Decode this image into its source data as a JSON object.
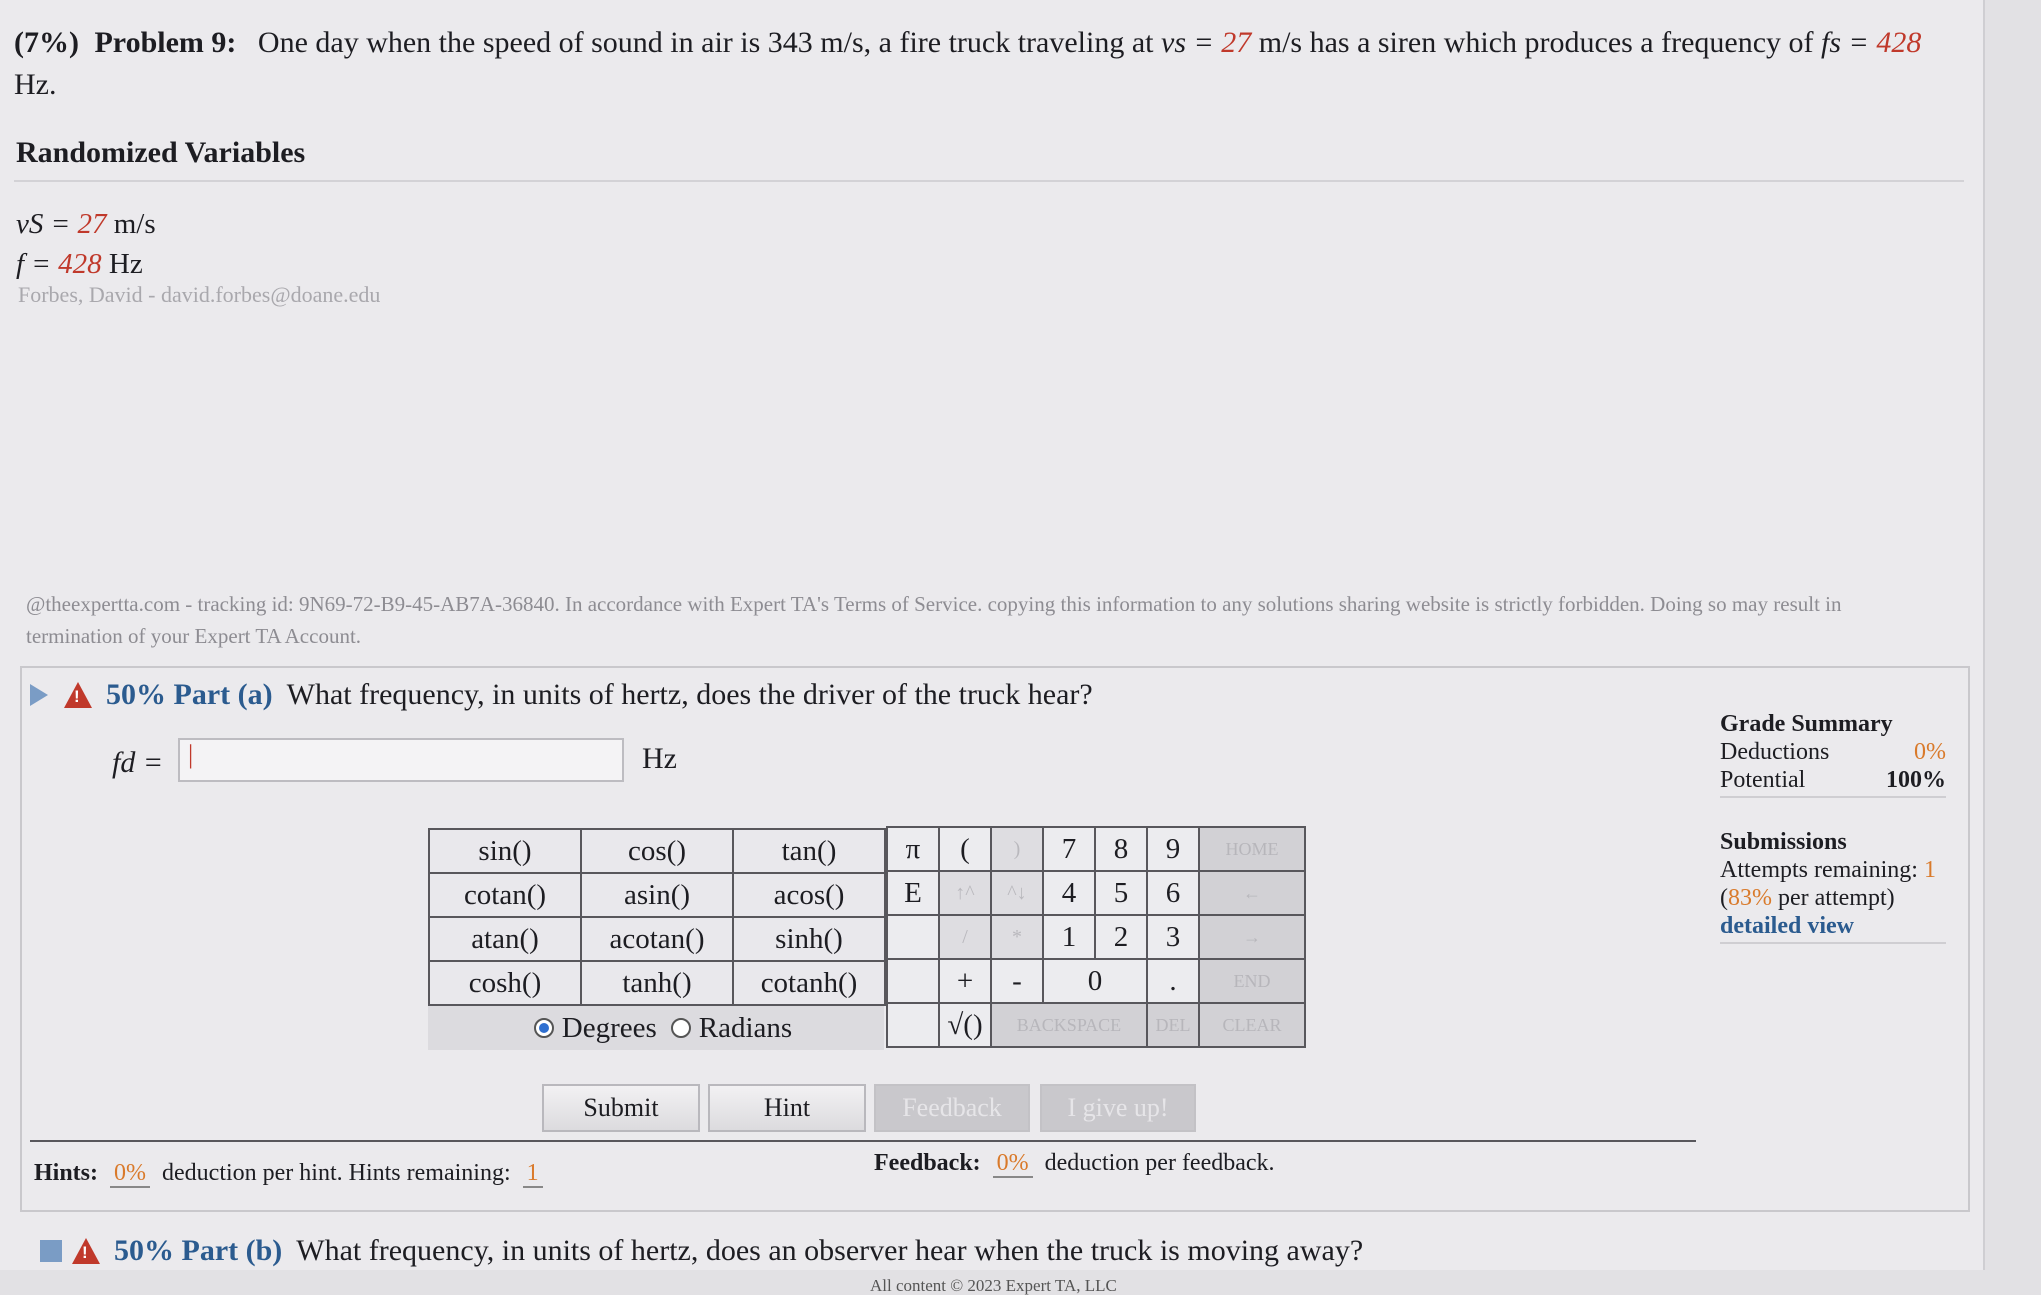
{
  "problem": {
    "pct": "(7%)",
    "label": "Problem 9:",
    "text_1": "One day when the speed of sound in air is 343 m/s, a fire truck traveling at",
    "vs_sym": "vs =",
    "vs_val": "27",
    "text_2": "m/s has a siren which produces a frequency of",
    "fs_sym": "fs =",
    "fs_val": "428",
    "text_3": "Hz."
  },
  "randomized": {
    "title": "Randomized Variables",
    "vs_label": "vS =",
    "vs_value": "27",
    "vs_unit": "m/s",
    "f_label": "f =",
    "f_value": "428",
    "f_unit": "Hz",
    "author": "Forbes, David - david.forbes@doane.edu"
  },
  "tracking": "@theexpertta.com - tracking id: 9N69-72-B9-45-AB7A-36840. In accordance with Expert TA's Terms of Service. copying this information to any solutions sharing website is strictly forbidden. Doing so may result in termination of your Expert TA Account.",
  "part_a": {
    "pct": "50% Part (a)",
    "question": "What frequency, in units of hertz, does the driver of the truck hear?",
    "answer_label": "fd =",
    "answer_value": "|",
    "unit": "Hz"
  },
  "functions": [
    [
      "sin()",
      "cos()",
      "tan()"
    ],
    [
      "cotan()",
      "asin()",
      "acos()"
    ],
    [
      "atan()",
      "acotan()",
      "sinh()"
    ],
    [
      "cosh()",
      "tanh()",
      "cotanh()"
    ]
  ],
  "angle": {
    "degrees": "Degrees",
    "radians": "Radians",
    "selected": "Degrees"
  },
  "keypad": {
    "pi": "π",
    "lparen": "(",
    "rparen": ")",
    "e": "E",
    "up": "↑^",
    "down": "^↓",
    "slash": "/",
    "star": "*",
    "plus": "+",
    "minus": "-",
    "dot": ".",
    "sqrt": "√()",
    "d7": "7",
    "d8": "8",
    "d9": "9",
    "d4": "4",
    "d5": "5",
    "d6": "6",
    "d1": "1",
    "d2": "2",
    "d3": "3",
    "d0": "0",
    "home": "HOME",
    "left": "←",
    "right": "→",
    "end": "END",
    "backspace": "BACKSPACE",
    "del": "DEL",
    "clear": "CLEAR"
  },
  "buttons": {
    "submit": "Submit",
    "hint": "Hint",
    "feedback": "Feedback",
    "giveup": "I give up!"
  },
  "hints": {
    "label": "Hints:",
    "pct": "0%",
    "text": "deduction per hint. Hints remaining:",
    "remaining": "1"
  },
  "feedback": {
    "label": "Feedback:",
    "pct": "0%",
    "text": "deduction per feedback."
  },
  "part_b": {
    "pct": "50% Part (b)",
    "question": "What frequency, in units of hertz, does an observer hear when the truck is moving away?"
  },
  "grade_summary": {
    "title": "Grade Summary",
    "deductions_label": "Deductions",
    "deductions_value": "0%",
    "potential_label": "Potential",
    "potential_value": "100%"
  },
  "submissions": {
    "title": "Submissions",
    "attempts_label": "Attempts remaining:",
    "attempts_value": "1",
    "per_attempt_pct": "83%",
    "per_attempt_text": "per attempt)",
    "detailed": "detailed view"
  },
  "footer": "All content © 2023 Expert TA, LLC"
}
